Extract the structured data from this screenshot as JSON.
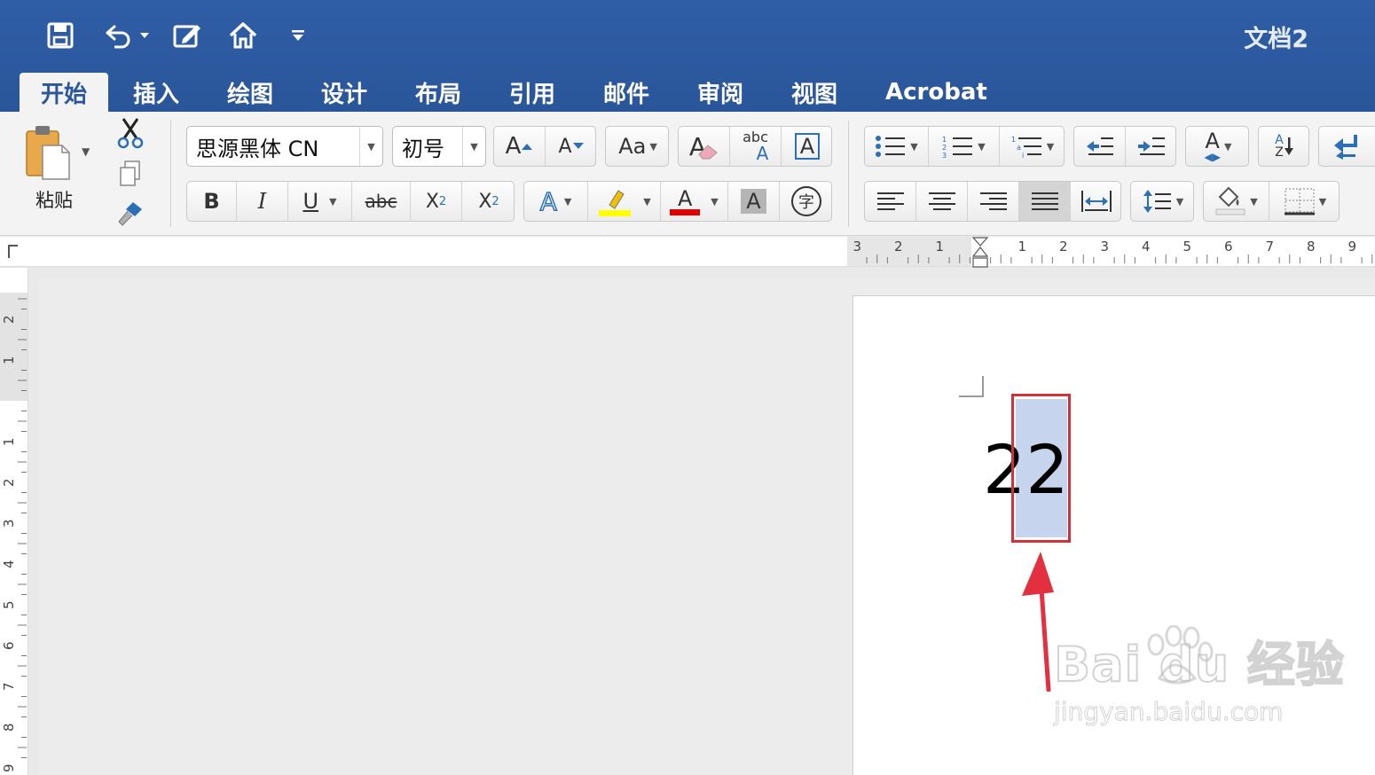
{
  "app": {
    "doc_title": "文档2"
  },
  "qat": {
    "save_icon": "save-icon",
    "undo_icon": "undo-icon",
    "edit_icon": "edit-icon",
    "home_icon": "home-icon",
    "customize_icon": "customize-icon"
  },
  "tabs": [
    {
      "label": "开始",
      "active": true
    },
    {
      "label": "插入"
    },
    {
      "label": "绘图"
    },
    {
      "label": "设计"
    },
    {
      "label": "布局"
    },
    {
      "label": "引用"
    },
    {
      "label": "邮件"
    },
    {
      "label": "审阅"
    },
    {
      "label": "视图"
    },
    {
      "label": "Acrobat"
    }
  ],
  "ribbon": {
    "paste_label": "粘贴",
    "font_name": "思源黑体 CN",
    "font_size": "初号",
    "bold": "B",
    "italic": "I",
    "underline": "U",
    "strike": "abc",
    "subscript": "X",
    "subscript_small": "2",
    "superscript": "X",
    "superscript_small": "2",
    "grow_font": "A",
    "shrink_font": "A",
    "change_case": "Aa",
    "clear_format": "A",
    "phonetic_top": "abc",
    "phonetic_bottom": "A",
    "char_border": "A",
    "text_effect": "A",
    "font_color": "A",
    "char_shading": "A",
    "enclose_char": "字",
    "styles": "A",
    "sort_a": "A",
    "sort_z": "Z",
    "colors": {
      "accent": "#2b579a",
      "highlight": "#ffff00",
      "font_color_bar": "#e00000",
      "selection": "#c6d4ee",
      "callout": "#d0323a"
    }
  },
  "ruler": {
    "h_labels": [
      "3",
      "2",
      "1",
      "1",
      "2",
      "3",
      "4",
      "5",
      "6",
      "7",
      "8",
      "9"
    ],
    "v_labels": [
      "2",
      "1",
      "1",
      "2",
      "3",
      "4",
      "5",
      "6",
      "7",
      "8",
      "9"
    ]
  },
  "document": {
    "text": "22"
  },
  "watermark": {
    "brand": "Bai du 经验",
    "url": "jingyan.baidu.com"
  }
}
